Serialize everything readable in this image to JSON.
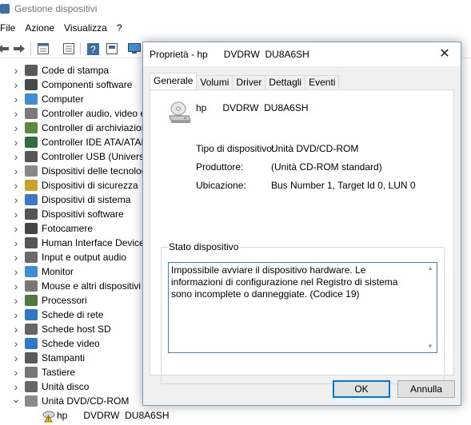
{
  "background_window": {
    "title": "Gestione dispositivi",
    "menu": [
      "File",
      "Azione",
      "Visualizza",
      "?"
    ],
    "toolbar_icons": [
      "back-arrow-icon",
      "forward-arrow-icon",
      "properties-icon",
      "list-view-icon",
      "help-icon",
      "details-view-icon",
      "monitor-icon"
    ],
    "tree": {
      "items": [
        {
          "label": "Code di stampa",
          "icon": "printer-icon",
          "color": "#5a5a5a"
        },
        {
          "label": "Componenti software",
          "icon": "software-component-icon",
          "color": "#4a4a4a"
        },
        {
          "label": "Computer",
          "icon": "computer-icon",
          "color": "#3c8fd6"
        },
        {
          "label": "Controller audio, video e giochi",
          "icon": "audio-icon",
          "color": "#7a7a7a"
        },
        {
          "label": "Controller di archiviazione",
          "icon": "storage-controller-icon",
          "color": "#5b8a3a"
        },
        {
          "label": "Controller IDE ATA/ATAPI",
          "icon": "ide-icon",
          "color": "#2f6f3e"
        },
        {
          "label": "Controller USB (Universal Serial Bus)",
          "icon": "usb-icon",
          "color": "#555555"
        },
        {
          "label": "Dispositivi delle tecnologie di memoria",
          "icon": "memory-icon",
          "color": "#888888"
        },
        {
          "label": "Dispositivi di sicurezza",
          "icon": "security-icon",
          "color": "#c9a227"
        },
        {
          "label": "Dispositivi di sistema",
          "icon": "system-device-icon",
          "color": "#3c78c8"
        },
        {
          "label": "Dispositivi software",
          "icon": "software-device-icon",
          "color": "#555555"
        },
        {
          "label": "Fotocamere",
          "icon": "camera-icon",
          "color": "#444444"
        },
        {
          "label": "Human Interface Devices",
          "icon": "hid-icon",
          "color": "#555555"
        },
        {
          "label": "Input e output audio",
          "icon": "speaker-icon",
          "color": "#6a6a6a"
        },
        {
          "label": "Monitor",
          "icon": "monitor-icon",
          "color": "#3c8fd6"
        },
        {
          "label": "Mouse e altri dispositivi di puntamento",
          "icon": "mouse-icon",
          "color": "#777777"
        },
        {
          "label": "Processori",
          "icon": "processor-icon",
          "color": "#4f7a3a"
        },
        {
          "label": "Schede di rete",
          "icon": "network-adapter-icon",
          "color": "#2d78c8"
        },
        {
          "label": "Schede host SD",
          "icon": "sd-host-icon",
          "color": "#666666"
        },
        {
          "label": "Schede video",
          "icon": "display-adapter-icon",
          "color": "#2d78c8"
        },
        {
          "label": "Stampanti",
          "icon": "printer-icon",
          "color": "#5a5a5a"
        },
        {
          "label": "Tastiere",
          "icon": "keyboard-icon",
          "color": "#777777"
        },
        {
          "label": "Unità disco",
          "icon": "disk-drive-icon",
          "color": "#666666"
        },
        {
          "label": "Unità DVD/CD-ROM",
          "icon": "dvd-drive-icon",
          "color": "#8a8a8a"
        }
      ],
      "expanded_child": {
        "label": "hp      DVDRW  DU8A6SH",
        "icon": "warning-dvd-icon"
      }
    }
  },
  "dialog": {
    "title": "Proprietà - hp      DVDRW  DU8A6SH",
    "close_symbol": "✕",
    "tabs": [
      "Generale",
      "Volumi",
      "Driver",
      "Dettagli",
      "Eventi"
    ],
    "active_tab": "Generale",
    "device_name": "hp      DVDRW  DU8A6SH",
    "properties": [
      {
        "label": "Tipo di dispositivo:",
        "value": "Unità DVD/CD-ROM"
      },
      {
        "label": "Produttore:",
        "value": "(Unità CD-ROM standard)"
      },
      {
        "label": "Ubicazione:",
        "value": "Bus Number 1, Target Id 0, LUN 0"
      }
    ],
    "status_group_label": "Stato dispositivo",
    "status_text": "Impossibile avviare il dispositivo hardware. Le informazioni di configurazione nel Registro di sistema sono incomplete o danneggiate. (Codice 19)",
    "ok_label": "OK",
    "cancel_label": "Annulla"
  },
  "colors": {
    "accent": "#0078d7",
    "dialog_bg": "#f0f0f0",
    "border": "#7a9cc6"
  }
}
